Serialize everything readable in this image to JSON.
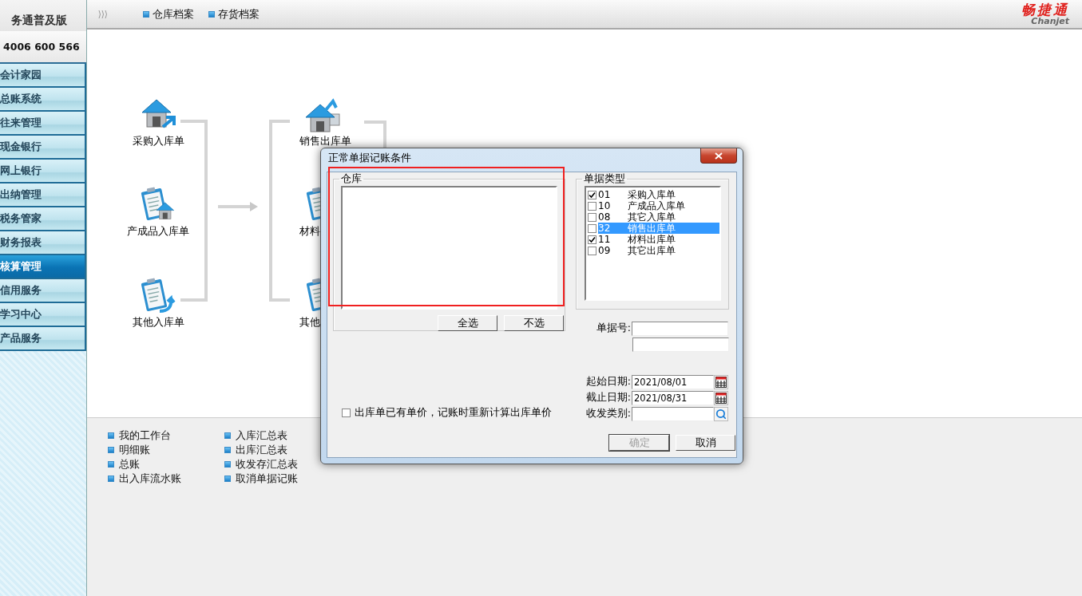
{
  "sidebar": {
    "brand": "务通普及版",
    "hotline": "4006 600 566",
    "items": [
      {
        "label": "会计家园",
        "selected": false
      },
      {
        "label": "总账系统",
        "selected": false
      },
      {
        "label": "往来管理",
        "selected": false
      },
      {
        "label": "现金银行",
        "selected": false
      },
      {
        "label": "网上银行",
        "selected": false
      },
      {
        "label": "出纳管理",
        "selected": false
      },
      {
        "label": "税务管家",
        "selected": false
      },
      {
        "label": "财务报表",
        "selected": false
      },
      {
        "label": "核算管理",
        "selected": true
      },
      {
        "label": "信用服务",
        "selected": false
      },
      {
        "label": "学习中心",
        "selected": false
      },
      {
        "label": "产品服务",
        "selected": false
      }
    ]
  },
  "topbar": {
    "links": [
      "仓库档案",
      "存货档案"
    ],
    "logo": {
      "name": "畅捷通",
      "latin": "Chanjet"
    }
  },
  "flow": {
    "inbound": [
      {
        "label": "采购入库单",
        "kind": "house"
      },
      {
        "label": "产成品入库单",
        "kind": "clipboard-house"
      },
      {
        "label": "其他入库单",
        "kind": "clipboard-arrow"
      }
    ],
    "outbound": [
      {
        "label": "销售出库单",
        "kind": "house-tray"
      },
      {
        "label": "材料",
        "kind": "clipboard"
      },
      {
        "label": "其他",
        "kind": "clipboard"
      }
    ]
  },
  "links": [
    [
      "我的工作台",
      "明细账",
      "总账",
      "出入库流水账"
    ],
    [
      "入库汇总表",
      "出库汇总表",
      "收发存汇总表",
      "取消单据记账"
    ]
  ],
  "dialog": {
    "title": "正常单据记账条件",
    "warehouse": {
      "legend": "仓库",
      "buttons": [
        "全选",
        "不选"
      ]
    },
    "doc_types": {
      "legend": "单据类型",
      "items": [
        {
          "code": "01",
          "name": "采购入库单",
          "checked": true,
          "selected": false
        },
        {
          "code": "10",
          "name": "产成品入库单",
          "checked": false,
          "selected": false
        },
        {
          "code": "08",
          "name": "其它入库单",
          "checked": false,
          "selected": false
        },
        {
          "code": "32",
          "name": "销售出库单",
          "checked": false,
          "selected": true
        },
        {
          "code": "11",
          "name": "材料出库单",
          "checked": true,
          "selected": false
        },
        {
          "code": "09",
          "name": "其它出库单",
          "checked": false,
          "selected": false
        }
      ]
    },
    "doc_no": {
      "label": "单据号:"
    },
    "start_date": {
      "label": "起始日期:",
      "value": "2021/08/01"
    },
    "end_date": {
      "label": "截止日期:",
      "value": "2021/08/31"
    },
    "category": {
      "label": "收发类别:"
    },
    "recalc": {
      "label": "出库单已有单价，记账时重新计算出库单价",
      "checked": false
    },
    "buttons": [
      {
        "label": "确定",
        "disabled": true
      },
      {
        "label": "取消",
        "disabled": false
      }
    ]
  }
}
